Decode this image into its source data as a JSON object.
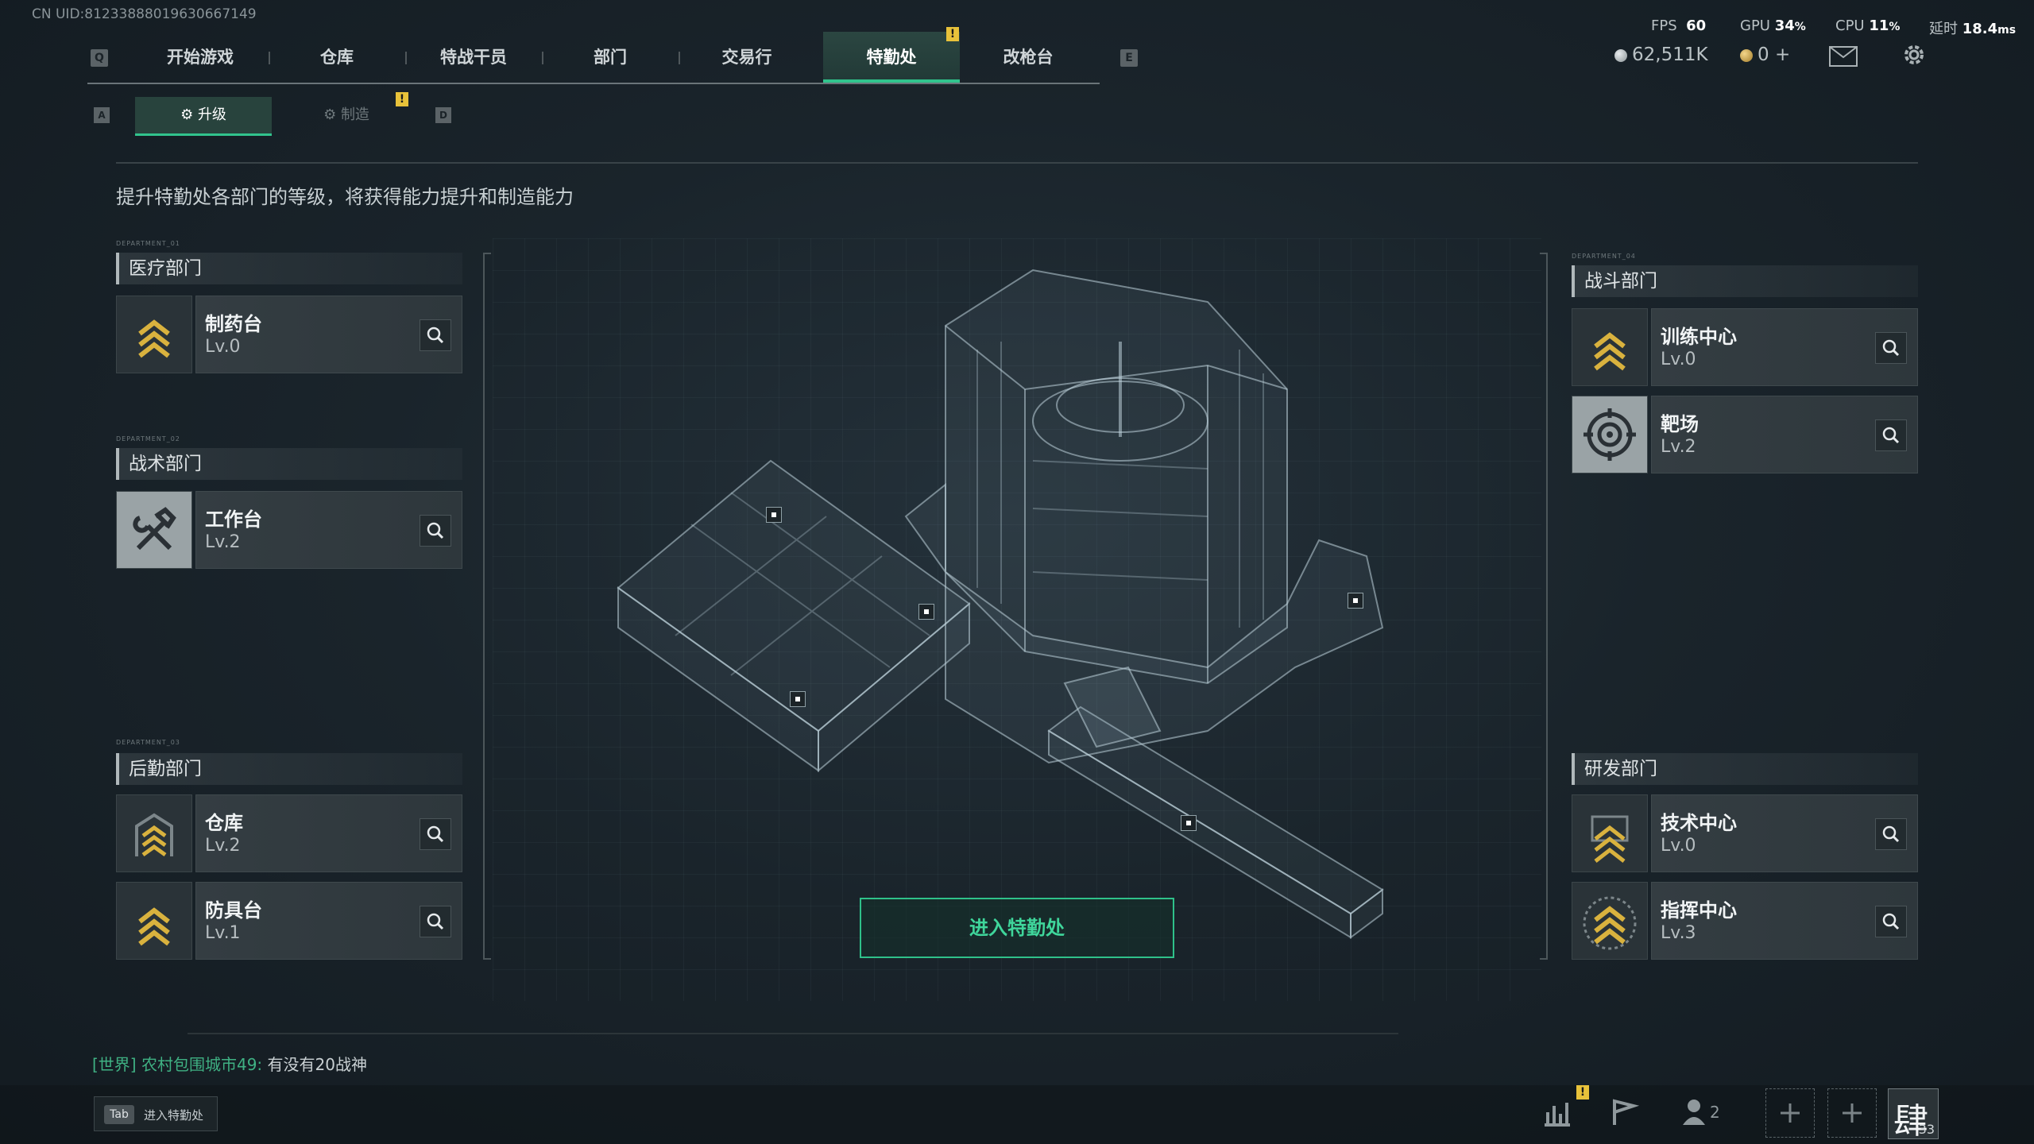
{
  "uid": "CN UID:81233888019630667149",
  "nav": {
    "left_key": "Q",
    "right_key": "E",
    "tabs": [
      "开始游戏",
      "仓库",
      "特战干员",
      "部门",
      "交易行",
      "特勤处",
      "改枪台"
    ],
    "active_index": 5,
    "alert_badge": "!"
  },
  "stats": {
    "fps_label": "FPS",
    "fps_value": "60",
    "gpu_label": "GPU",
    "gpu_value": "34",
    "cpu_label": "CPU",
    "cpu_value": "11",
    "latency_label": "延时",
    "latency_value": "18.4",
    "percent_unit": "%",
    "ms_unit": "ms"
  },
  "currency": {
    "silver": "62,511K",
    "gold": "0",
    "gold_plus": "+"
  },
  "subtabs": {
    "left_key": "A",
    "right_key": "D",
    "upgrade": "升级",
    "craft": "制造",
    "alert_badge": "!"
  },
  "description": "提升特勤处各部门的等级，将获得能力提升和制造能力",
  "departments": {
    "medical": {
      "micro": "DEPARTMENT_01",
      "title": "医疗部门",
      "items": [
        {
          "name": "制药台",
          "level": "Lv.0"
        }
      ]
    },
    "tactical": {
      "micro": "DEPARTMENT_02",
      "title": "战术部门",
      "items": [
        {
          "name": "工作台",
          "level": "Lv.2"
        }
      ]
    },
    "logistics": {
      "micro": "DEPARTMENT_03",
      "title": "后勤部门",
      "items": [
        {
          "name": "仓库",
          "level": "Lv.2"
        },
        {
          "name": "防具台",
          "level": "Lv.1"
        }
      ]
    },
    "combat": {
      "micro": "DEPARTMENT_04",
      "title": "战斗部门",
      "items": [
        {
          "name": "训练中心",
          "level": "Lv.0"
        },
        {
          "name": "靶场",
          "level": "Lv.2"
        }
      ]
    },
    "research": {
      "title": "研发部门",
      "items": [
        {
          "name": "技术中心",
          "level": "Lv.0"
        },
        {
          "name": "指挥中心",
          "level": "Lv.3"
        }
      ]
    }
  },
  "enter_button": "进入特勤处",
  "chat": {
    "channel": "[世界]",
    "sender": "农村包围城市49:",
    "message": "有没有20战神"
  },
  "tab_hint": {
    "key": "Tab",
    "label": "进入特勤处"
  },
  "dock": {
    "friends_count": "2",
    "avatar_glyph": "肆",
    "avatar_level": "33",
    "alert_badge": "!"
  },
  "colors": {
    "accent": "#31c48d",
    "badge": "#e8c23a",
    "background": "#1a242b"
  },
  "icons": [
    "search-icon",
    "mail-icon",
    "settings-icon",
    "chevron-upgrade-icon",
    "hammer-wrench-icon",
    "target-icon",
    "stats-icon",
    "flag-icon",
    "friends-icon",
    "add-icon"
  ]
}
